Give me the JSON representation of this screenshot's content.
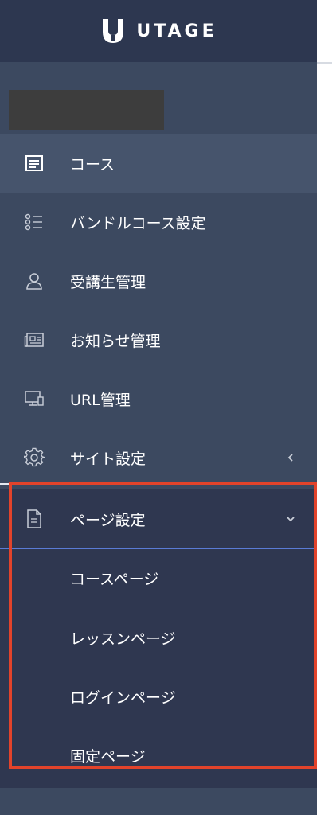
{
  "brand": {
    "name": "UTAGE"
  },
  "sidebar": {
    "items": [
      {
        "label": "コース",
        "icon": "document-list-icon",
        "active": true
      },
      {
        "label": "バンドルコース設定",
        "icon": "bullet-list-icon"
      },
      {
        "label": "受講生管理",
        "icon": "user-icon"
      },
      {
        "label": "お知らせ管理",
        "icon": "newspaper-icon"
      },
      {
        "label": "URL管理",
        "icon": "monitor-icon"
      },
      {
        "label": "サイト設定",
        "icon": "gear-icon",
        "chevron": "‹"
      },
      {
        "label": "ページ設定",
        "icon": "file-icon",
        "chevron": "⌄"
      }
    ],
    "submenu": [
      {
        "label": "コースページ"
      },
      {
        "label": "レッスンページ"
      },
      {
        "label": "ログインページ"
      },
      {
        "label": "固定ページ"
      }
    ]
  },
  "colors": {
    "sidebar_bg": "#3c4960",
    "header_bg": "#2d3750",
    "submenu_bg": "#2f3750",
    "active_bg": "#46546c",
    "highlight_border": "#e2432b",
    "divider_accent": "#5a7bd6"
  }
}
